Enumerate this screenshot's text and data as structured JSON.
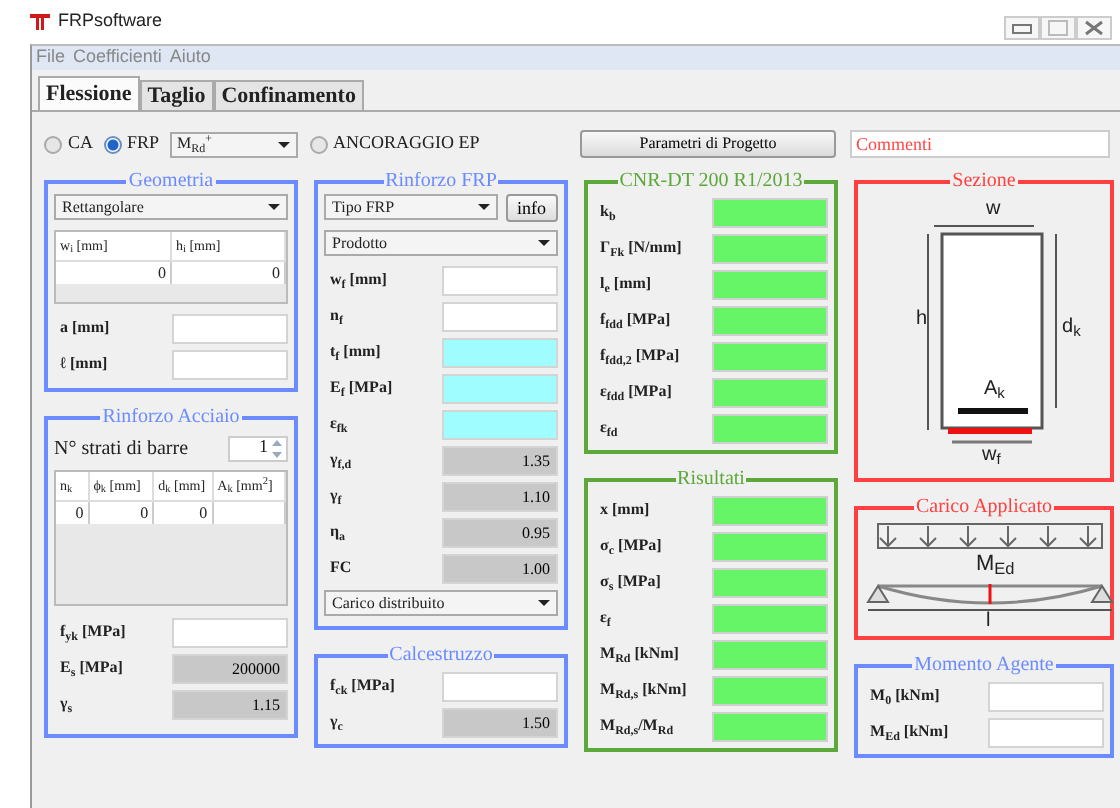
{
  "app": {
    "title": "FRPsoftware"
  },
  "menu": [
    "File",
    "Coefficienti",
    "Aiuto"
  ],
  "tabs": [
    {
      "label": "Flessione",
      "selected": true
    },
    {
      "label": "Taglio",
      "selected": false
    },
    {
      "label": "Confinamento",
      "selected": false
    }
  ],
  "toolbar": {
    "options": [
      {
        "label": "CA",
        "selected": false
      },
      {
        "label": "FRP",
        "selected": true
      }
    ],
    "moment_select": "M$_{Rd}$$^{+}$",
    "anchorage": {
      "label": "ANCORAGGIO EP",
      "selected": false
    },
    "params_button": "Parametri di Progetto",
    "comments": {
      "placeholder": "Commenti"
    }
  },
  "geometria": {
    "title": "Geometria",
    "shape_select": "Rettangolare",
    "table": {
      "columns": [
        "w$_{i}$ [mm]",
        "h$_{i}$ [mm]"
      ],
      "rows": [
        [
          "0",
          "0"
        ]
      ]
    },
    "fields": [
      {
        "label": "a [mm]",
        "kind": "input"
      },
      {
        "label": "ℓ [mm]",
        "kind": "input"
      }
    ]
  },
  "rinforzo_acciaio": {
    "title": "Rinforzo Acciaio",
    "layers_label": "N° strati di barre",
    "layers_value": "1",
    "table": {
      "columns": [
        "n$_{k}$",
        "ϕ$_{k}$ [mm]",
        "d$_{k}$ [mm]",
        "A$_{k}$ [mm$^{2}$]"
      ],
      "rows": [
        [
          "0",
          "0",
          "0"
        ]
      ]
    },
    "fields": [
      {
        "label": "f$_{yk}$ [MPa]",
        "kind": "input"
      },
      {
        "label": "E$_{s}$ [MPa]",
        "kind": "fixed",
        "value": "200000"
      },
      {
        "label": "γ$_{s}$",
        "kind": "fixed",
        "value": "1.15"
      }
    ]
  },
  "rinforzo_frp": {
    "title": "Rinforzo FRP",
    "type_select": "Tipo FRP",
    "info_button": "info",
    "product_select": "Prodotto",
    "fields": [
      {
        "label": "w$_{f}$ [mm]",
        "kind": "input"
      },
      {
        "label": "n$_{f}$",
        "kind": "input"
      },
      {
        "label": "t$_{f}$ [mm]",
        "kind": "required"
      },
      {
        "label": "E$_{f}$ [MPa]",
        "kind": "required"
      },
      {
        "label": "ε$_{fk}$",
        "kind": "required"
      },
      {
        "label": "γ$_{f,d}$",
        "kind": "fixed",
        "value": "1.35"
      },
      {
        "label": "γ$_{f}$",
        "kind": "fixed",
        "value": "1.10"
      },
      {
        "label": "η$_{a}$",
        "kind": "fixed",
        "value": "0.95"
      },
      {
        "label": "FC",
        "kind": "fixed",
        "value": "1.00"
      }
    ],
    "load_select": "Carico distribuito"
  },
  "calcestruzzo": {
    "title": "Calcestruzzo",
    "fields": [
      {
        "label": "f$_{ck}$ [MPa]",
        "kind": "input"
      },
      {
        "label": "γ$_{c}$",
        "kind": "fixed",
        "value": "1.50"
      }
    ]
  },
  "cnr": {
    "title": "CNR-DT 200 R1/2013",
    "fields": [
      {
        "label": "k$_{b}$",
        "kind": "output"
      },
      {
        "label": "Γ$_{Fk}$ [N/mm]",
        "kind": "output"
      },
      {
        "label": "l$_{e}$ [mm]",
        "kind": "output"
      },
      {
        "label": "f$_{fdd}$ [MPa]",
        "kind": "output"
      },
      {
        "label": "f$_{fdd,2}$ [MPa]",
        "kind": "output"
      },
      {
        "label": "ε$_{fdd}$ [MPa]",
        "kind": "output"
      },
      {
        "label": "ε$_{fd}$",
        "kind": "output"
      }
    ]
  },
  "risultati": {
    "title": "Risultati",
    "fields": [
      {
        "label": "x [mm]",
        "kind": "output"
      },
      {
        "label": "σ$_{c}$ [MPa]",
        "kind": "output"
      },
      {
        "label": "σ$_{s}$ [MPa]",
        "kind": "output"
      },
      {
        "label": "ε$_{f}$",
        "kind": "output"
      },
      {
        "label": "M$_{Rd}$ [kNm]",
        "kind": "output"
      },
      {
        "label": "M$_{Rd,s}$ [kNm]",
        "kind": "output"
      },
      {
        "label": "M$_{Rd,s}$/M$_{Rd}$",
        "kind": "output"
      }
    ]
  },
  "sezione": {
    "title": "Sezione",
    "labels": {
      "width": "w",
      "height": "h",
      "depth": "d$_{k}$",
      "area": "A$_{k}$",
      "frp_width": "w$_{f}$"
    }
  },
  "carico": {
    "title": "Carico Applicato",
    "moment_label": "M$_{Ed}$",
    "span_label": "l"
  },
  "momento": {
    "title": "Momento Agente",
    "fields": [
      {
        "label": "M$_{0}$ [kNm]",
        "kind": "input"
      },
      {
        "label": "M$_{Ed}$ [kNm]",
        "kind": "input"
      }
    ]
  }
}
